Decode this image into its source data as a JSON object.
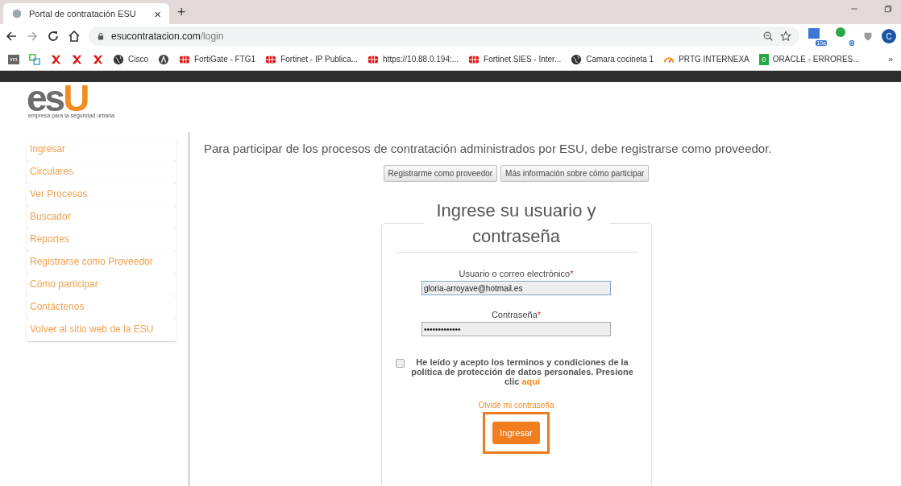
{
  "browser": {
    "tabs": [
      {
        "title": "Portal de contratación ESU",
        "close": "×",
        "selected": true
      }
    ],
    "new_tab": "+",
    "url_host": "esucontratacion.com",
    "url_path": "/login",
    "extension_badges": [
      "10a",
      "9"
    ],
    "avatar": "C",
    "bookmarks": [
      {
        "kind": "vm",
        "label": "vm"
      },
      {
        "kind": "boxes"
      },
      {
        "kind": "red"
      },
      {
        "kind": "red"
      },
      {
        "kind": "red"
      },
      {
        "kind": "globe",
        "label": "Cisco"
      },
      {
        "kind": "dark"
      },
      {
        "kind": "forti",
        "label": "FortiGate - FTG1"
      },
      {
        "kind": "forti",
        "label": "Fortinet - IP Publica..."
      },
      {
        "kind": "forti",
        "label": "https://10.88.0.194:..."
      },
      {
        "kind": "forti",
        "label": "Fortinet SIES - Inter..."
      },
      {
        "kind": "globe",
        "label": "Camara cocineta 1"
      },
      {
        "kind": "gauge",
        "label": "PRTG INTERNEXA"
      },
      {
        "kind": "green",
        "badge": "0",
        "label": "ORACLE - ERRORES..."
      }
    ],
    "more": "»"
  },
  "logo": {
    "gray": "es",
    "orange": "U",
    "tagline": "empresa para la seguridad urbana"
  },
  "sidebar": {
    "items": [
      {
        "label": "Ingresar"
      },
      {
        "label": "Circulares"
      },
      {
        "label": "Ver Procesos"
      },
      {
        "label": "Buscador"
      },
      {
        "label": "Reportes"
      },
      {
        "label": "Registrarse como Proveedor"
      },
      {
        "label": "Cómo participar"
      },
      {
        "label": "Contáctenos"
      },
      {
        "label": "Volver al sitio web de la ESU"
      }
    ]
  },
  "intro": "Para participar de los procesos de contratación administrados por ESU, debe registrarse como proveedor.",
  "intro_buttons": [
    "Registrarme como proveedor",
    "Más información sobre cómo participar"
  ],
  "login": {
    "title": "Ingrese su usuario y contraseña",
    "fields": [
      {
        "label": "Usuario o correo electrónico",
        "required": "*",
        "value": "gloria-arroyave@hotmail.es",
        "focused": true
      },
      {
        "label": "Contraseña",
        "required": "*",
        "value": "•••••••••••••",
        "focused": false
      }
    ],
    "terms": {
      "checked": false,
      "text": "He leído y acepto los terminos y condiciones de la política de protección de datos personales. Presione clic",
      "link": "aquí"
    },
    "forgot": "Olvidé mi contraseña",
    "submit": "Ingresar",
    "submit_highlighted": true
  }
}
